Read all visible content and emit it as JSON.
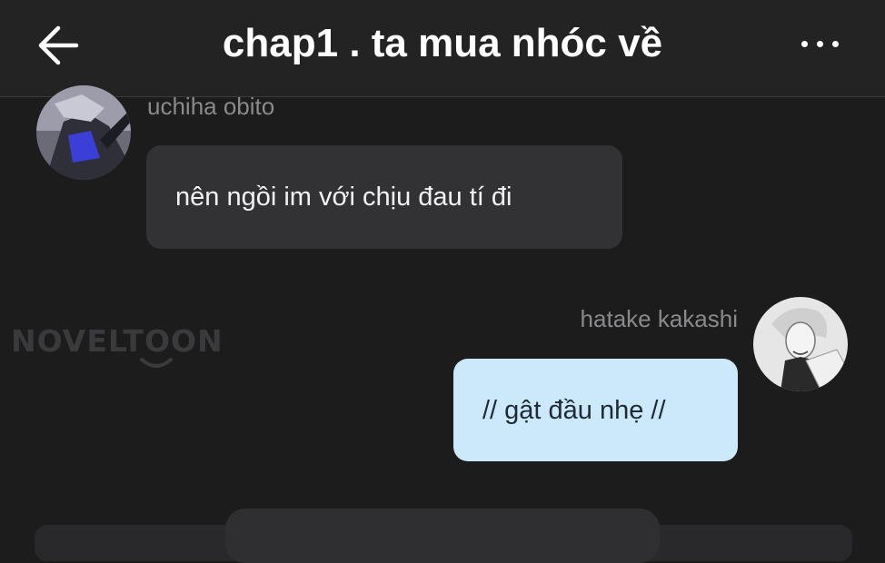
{
  "header": {
    "title": "chap1 . ta mua nhóc về",
    "back_icon": "arrow-left-icon",
    "more_icon": "more-horizontal-icon"
  },
  "messages": [
    {
      "sender": "uchiha obito",
      "text": "nên ngồi im với chịu đau tí đi",
      "side": "left"
    },
    {
      "sender": "hatake kakashi",
      "text": "// gật đầu nhẹ //",
      "side": "right"
    }
  ],
  "watermark": {
    "text": "NOVELTOON"
  },
  "colors": {
    "background": "#1c1c1d",
    "left_bubble": "#323234",
    "right_bubble": "#cbe9fb"
  }
}
